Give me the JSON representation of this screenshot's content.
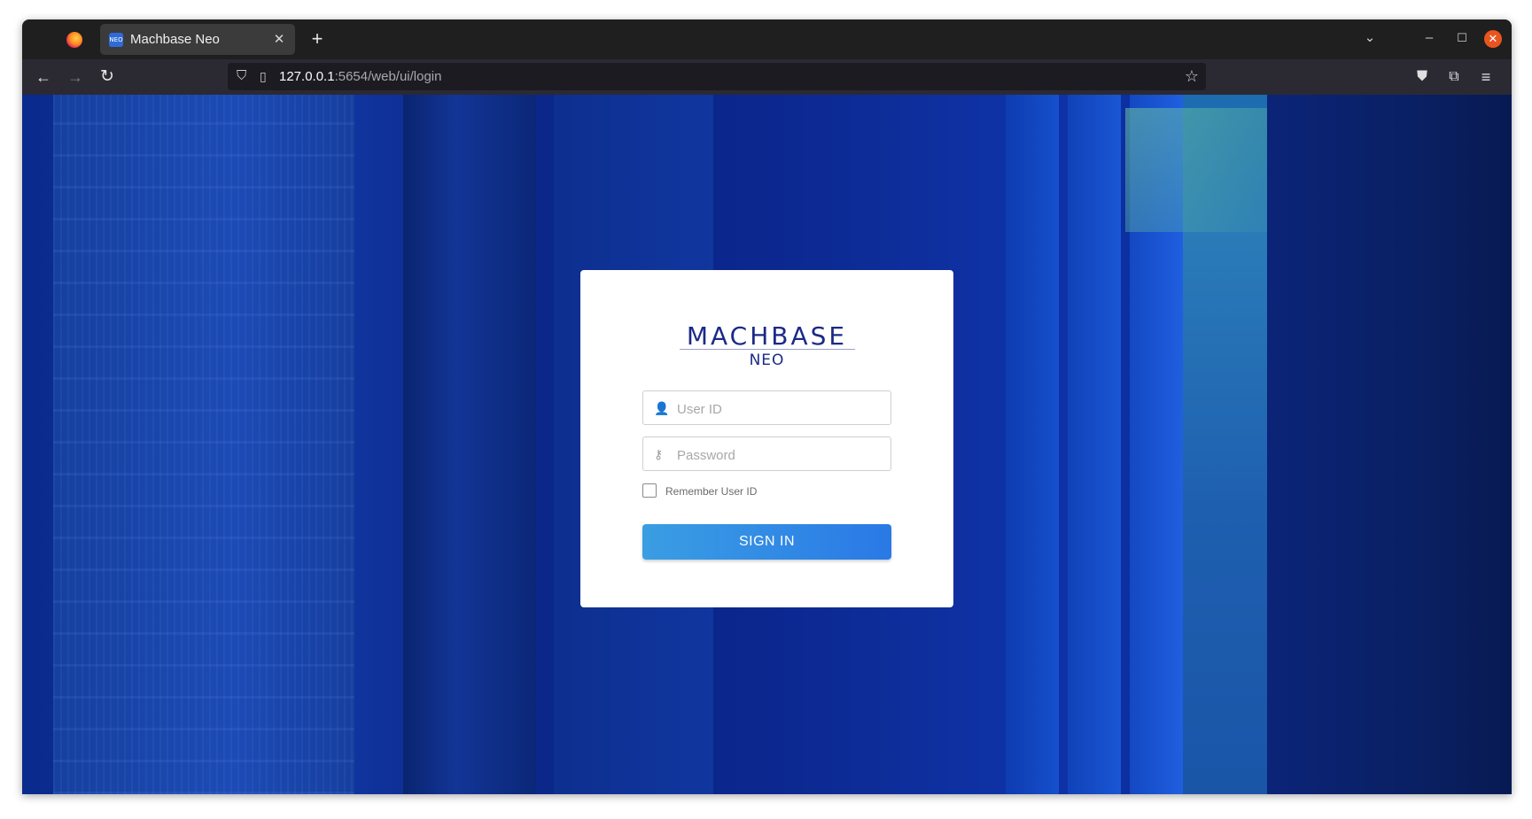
{
  "browser": {
    "tab": {
      "title": "Machbase Neo",
      "favicon_text": "NEO",
      "close_glyph": "✕"
    },
    "newtab_glyph": "+",
    "controls": {
      "list_all": "⌄",
      "minimize": "–",
      "maximize": "☐",
      "close": "✕"
    },
    "nav": {
      "back": "←",
      "forward": "→",
      "reload": "↻"
    },
    "url": {
      "host": "127.0.0.1",
      "rest": ":5654/web/ui/login"
    },
    "icons": {
      "shield": "⛉",
      "page": "▯",
      "star": "☆",
      "pocket": "⛊",
      "extensions": "⧉",
      "menu": "≡"
    }
  },
  "login": {
    "logo": {
      "main": "MACHBASE",
      "sub": "NEO"
    },
    "userid": {
      "placeholder": "User ID",
      "icon": "user-icon",
      "glyph": "👤"
    },
    "password": {
      "placeholder": "Password",
      "icon": "key-icon",
      "glyph": "⚷"
    },
    "remember_label": "Remember User ID",
    "signin_label": "SIGN IN"
  },
  "colors": {
    "brand": "#1b2a86",
    "button_start": "#3a9ee3",
    "button_end": "#2a79e6",
    "page_background": "#0b2a8a"
  }
}
